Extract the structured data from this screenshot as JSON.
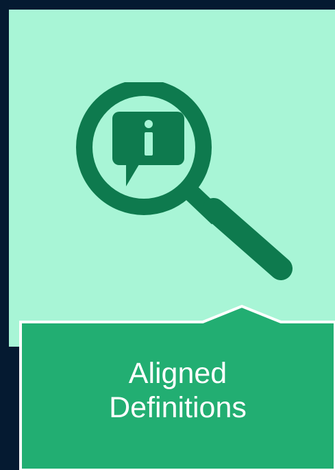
{
  "card": {
    "background_color": "#a8f5d6",
    "icon": "magnifying-glass-info-icon",
    "icon_color": "#0e7a4e"
  },
  "tab": {
    "background_color": "#22ae72",
    "title_line1": "Aligned",
    "title_line2": "Definitions"
  }
}
